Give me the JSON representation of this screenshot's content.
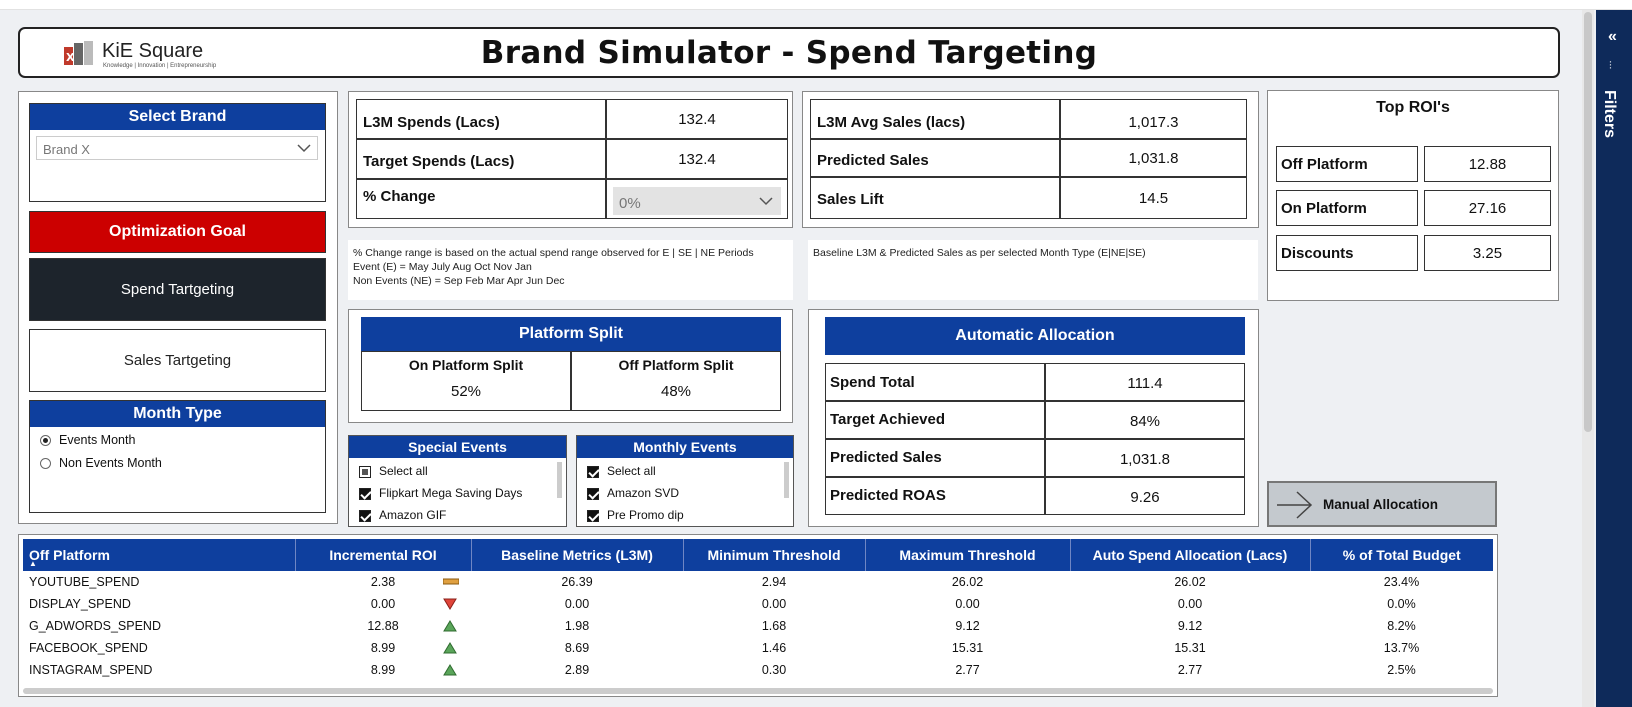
{
  "header": {
    "logo_text": "KiE Square",
    "logo_tagline": "Knowledge | Innovation | Entrepreneurship",
    "title": "Brand Simulator - Spend Targeting"
  },
  "left": {
    "select_brand_label": "Select Brand",
    "brand_value": "Brand X",
    "optimization_goal_label": "Optimization Goal",
    "spend_targeting_label": "Spend Tartgeting",
    "sales_targeting_label": "Sales Tartgeting",
    "month_type_label": "Month Type",
    "month_options": [
      "Events Month",
      "Non Events Month"
    ]
  },
  "spends": {
    "l3m_spends_label": "L3M Spends (Lacs)",
    "l3m_spends_value": "132.4",
    "target_spends_label": "Target Spends (Lacs)",
    "target_spends_value": "132.4",
    "pct_change_label": "% Change",
    "pct_change_value": "0%"
  },
  "sales": {
    "l3m_avg_sales_label": "L3M Avg Sales (lacs)",
    "l3m_avg_sales_value": "1,017.3",
    "predicted_sales_label": "Predicted Sales",
    "predicted_sales_value": "1,031.8",
    "sales_lift_label": "Sales Lift",
    "sales_lift_value": "14.5"
  },
  "notes": {
    "left_line1": "% Change range is based on the actual spend range observed for E | SE | NE  Periods",
    "left_line2": "Event (E) =   May July Aug Oct Nov Jan",
    "left_line3": "Non Events (NE) = Sep Feb Mar Apr Jun Dec",
    "right_line1": "Baseline L3M & Predicted Sales as per selected Month Type      (E|NE|SE)"
  },
  "top_roi": {
    "title": "Top ROI's",
    "rows": [
      {
        "label": "Off Platform",
        "value": "12.88"
      },
      {
        "label": "On Platform",
        "value": "27.16"
      },
      {
        "label": "Discounts",
        "value": "3.25"
      }
    ]
  },
  "platform_split": {
    "title": "Platform Split",
    "on_label": "On Platform Split",
    "on_value": "52%",
    "off_label": "Off Platform Split",
    "off_value": "48%"
  },
  "auto_alloc": {
    "title": "Automatic Allocation",
    "rows": [
      {
        "label": "Spend Total",
        "value": "111.4"
      },
      {
        "label": "Target Achieved",
        "value": "84%"
      },
      {
        "label": "Predicted Sales",
        "value": "1,031.8"
      },
      {
        "label": "Predicted ROAS",
        "value": "9.26"
      }
    ]
  },
  "manual_alloc_label": "Manual Allocation",
  "special_events": {
    "title": "Special Events",
    "items": [
      "Select all",
      "Flipkart Mega Saving Days",
      "Amazon GIF"
    ]
  },
  "monthly_events": {
    "title": "Monthly Events",
    "items": [
      "Select all",
      "Amazon SVD",
      "Pre Promo dip"
    ]
  },
  "filters_label": "Filters",
  "table": {
    "columns": [
      "Off Platform",
      "Incremental ROI",
      "Baseline Metrics (L3M)",
      "Minimum Threshold",
      "Maximum Threshold",
      "Auto Spend Allocation (Lacs)",
      "% of Total Budget"
    ],
    "rows": [
      {
        "name": "YOUTUBE_SPEND",
        "roi": "2.38",
        "trend": "flat",
        "baseline": "26.39",
        "min": "2.94",
        "max": "26.02",
        "auto": "26.02",
        "pct": "23.4%"
      },
      {
        "name": "DISPLAY_SPEND",
        "roi": "0.00",
        "trend": "down",
        "baseline": "0.00",
        "min": "0.00",
        "max": "0.00",
        "auto": "0.00",
        "pct": "0.0%"
      },
      {
        "name": "G_ADWORDS_SPEND",
        "roi": "12.88",
        "trend": "up",
        "baseline": "1.98",
        "min": "1.68",
        "max": "9.12",
        "auto": "9.12",
        "pct": "8.2%"
      },
      {
        "name": "FACEBOOK_SPEND",
        "roi": "8.99",
        "trend": "up",
        "baseline": "8.69",
        "min": "1.46",
        "max": "15.31",
        "auto": "15.31",
        "pct": "13.7%"
      },
      {
        "name": "INSTAGRAM_SPEND",
        "roi": "8.99",
        "trend": "up",
        "baseline": "2.89",
        "min": "0.30",
        "max": "2.77",
        "auto": "2.77",
        "pct": "2.5%"
      }
    ]
  },
  "colors": {
    "primary_blue": "#0e3f9e",
    "goal_red": "#cc0000",
    "dark_tile": "#1d242c",
    "trend_up": "#5aa55a",
    "trend_down": "#e0453a",
    "trend_flat": "#e0a040"
  }
}
